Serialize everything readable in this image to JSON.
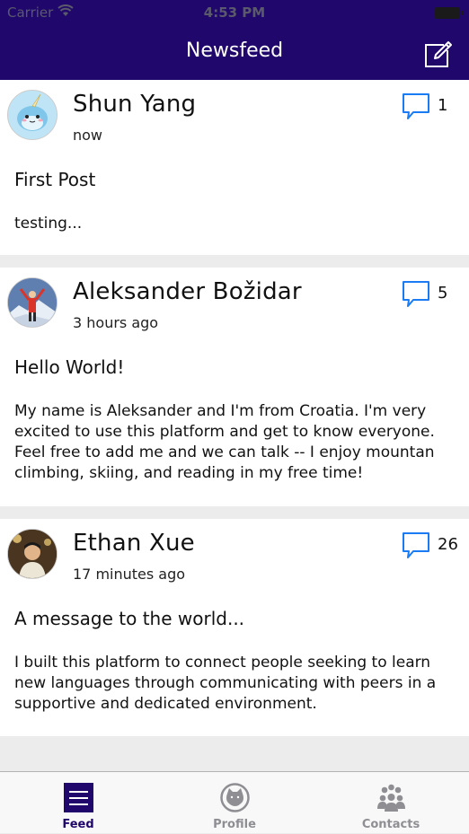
{
  "status_bar": {
    "carrier": "Carrier",
    "time": "4:53 PM"
  },
  "header": {
    "title": "Newsfeed",
    "compose_icon": "compose-icon"
  },
  "colors": {
    "header_bg": "#20076b",
    "accent_blue": "#1a7cf5",
    "active_tab": "#20076b",
    "inactive_tab": "#8e8e93"
  },
  "posts": [
    {
      "author": "Shun Yang",
      "time": "now",
      "comment_count": "1",
      "title": "First Post",
      "body": "testing...",
      "avatar_icon": "narwhal-avatar"
    },
    {
      "author": "Aleksander Božidar",
      "time": "3 hours ago",
      "comment_count": "5",
      "title": "Hello World!",
      "body": "My name is Aleksander and I'm from Croatia. I'm very excited to use this platform and get to know everyone. Feel free to add me and we can talk -- I enjoy mountan climbing, skiing, and reading in my free time!",
      "avatar_icon": "climber-avatar"
    },
    {
      "author": "Ethan Xue",
      "time": "17 minutes ago",
      "comment_count": "26",
      "title": "A message to the world...",
      "body": "I built this platform to connect people seeking to learn new languages through communicating with peers in a supportive and dedicated environment.",
      "avatar_icon": "person-avatar"
    }
  ],
  "tabs": [
    {
      "label": "Feed",
      "icon": "feed-icon",
      "active": true
    },
    {
      "label": "Profile",
      "icon": "profile-icon",
      "active": false
    },
    {
      "label": "Contacts",
      "icon": "contacts-icon",
      "active": false
    }
  ]
}
